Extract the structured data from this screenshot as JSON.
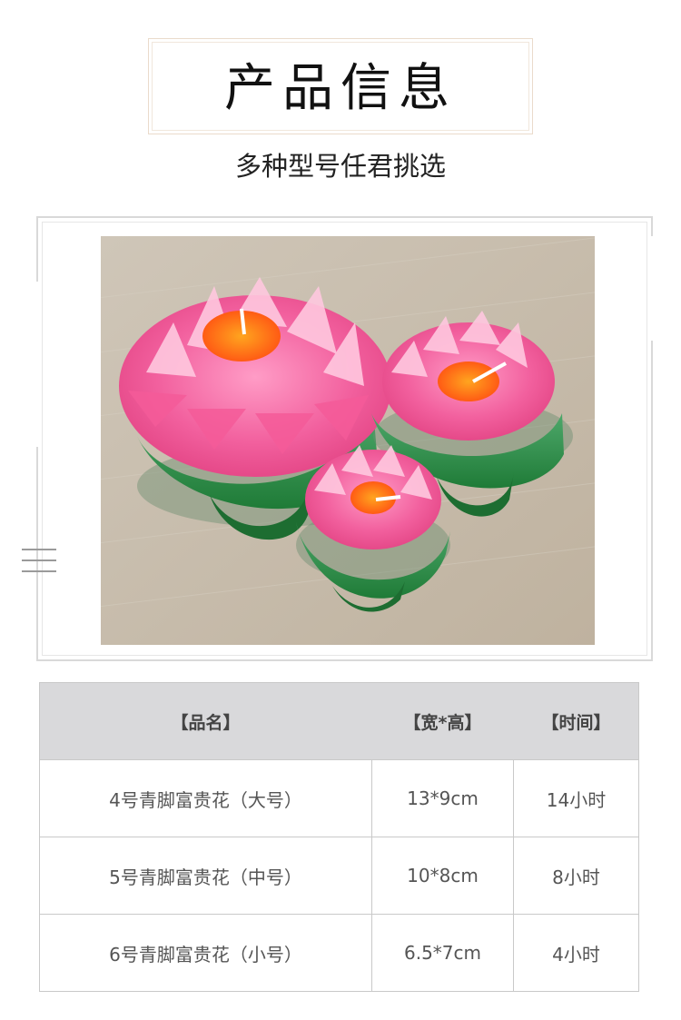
{
  "title": "产品信息",
  "subtitle": "多种型号任君挑选",
  "photo": {
    "colors": {
      "petal": "#f25a9a",
      "petal_light": "#ffb7d3",
      "center": "#ff6a16",
      "leaf": "#2f8f46",
      "wood": "#c9c0b1"
    }
  },
  "menu": {
    "icon": "menu-lines-icon"
  },
  "table": {
    "headers": [
      "【品名】",
      "【宽*高】",
      "【时间】"
    ],
    "rows": [
      [
        "4号青脚富贵花（大号）",
        "13*9cm",
        "14小时"
      ],
      [
        "5号青脚富贵花（中号）",
        "10*8cm",
        "8小时"
      ],
      [
        "6号青脚富贵花（小号）",
        "6.5*7cm",
        "4小时"
      ]
    ]
  }
}
